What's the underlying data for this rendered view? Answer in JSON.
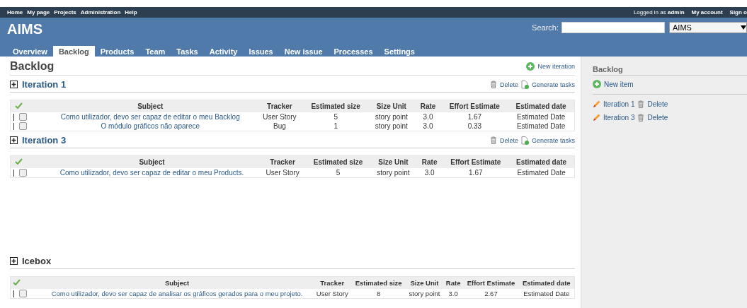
{
  "top_menu": [
    "Home",
    "My page",
    "Projects",
    "Administration",
    "Help"
  ],
  "account": {
    "logged_in_prefix": "Logged in as",
    "user": "admin",
    "links": [
      "My account",
      "Sign o"
    ]
  },
  "header": {
    "title": "AIMS",
    "search_label": "Search:",
    "project_select": "AIMS"
  },
  "tabs": [
    {
      "label": "Overview",
      "selected": false
    },
    {
      "label": "Backlog",
      "selected": true
    },
    {
      "label": "Products",
      "selected": false
    },
    {
      "label": "Team",
      "selected": false
    },
    {
      "label": "Tasks",
      "selected": false
    },
    {
      "label": "Activity",
      "selected": false
    },
    {
      "label": "Issues",
      "selected": false
    },
    {
      "label": "New issue",
      "selected": false
    },
    {
      "label": "Processes",
      "selected": false
    },
    {
      "label": "Settings",
      "selected": false
    }
  ],
  "page_title": "Backlog",
  "new_iteration": "New iteration",
  "sections": [
    {
      "kind": "iteration",
      "title": "Iteration 1",
      "actions": [
        "Delete",
        "Generate tasks"
      ],
      "columns": [
        "Subject",
        "Tracker",
        "Estimated size",
        "Size Unit",
        "Rate",
        "Effort Estimate",
        "Estimated date"
      ],
      "rows": [
        {
          "checked": false,
          "cells": [
            "Como utilizador, devo ser capaz de editar o meu Backlog",
            "User Story",
            "5",
            "story point",
            "3.0",
            "1.67",
            "Estimated Date"
          ]
        },
        {
          "checked": false,
          "cells": [
            "O módulo gráficos não aparece",
            "Bug",
            "1",
            "story point",
            "3.0",
            "0.33",
            "Estimated Date"
          ]
        }
      ]
    },
    {
      "kind": "iteration",
      "title": "Iteration 3",
      "actions": [
        "Delete",
        "Generate tasks"
      ],
      "columns": [
        "Subject",
        "Tracker",
        "Estimated size",
        "Size Unit",
        "Rate",
        "Effort Estimate",
        "Estimated date"
      ],
      "rows": [
        {
          "checked": false,
          "cells": [
            "Como utilizador, devo ser capaz de editar o meu Products.",
            "User Story",
            "5",
            "story point",
            "3.0",
            "1.67",
            "Estimated Date"
          ]
        }
      ]
    },
    {
      "kind": "icebox",
      "title": "Icebox",
      "columns": [
        "Subject",
        "Tracker",
        "Estimated size",
        "Size Unit",
        "Rate",
        "Effort Estimate",
        "Estimated date"
      ],
      "rows": [
        {
          "checked": false,
          "cells": [
            "Como utilizador, devo ser capaz de analisar os gráficos gerados para o meu projeto.",
            "User Story",
            "8",
            "story point",
            "3.0",
            "2.67",
            "Estimated Date"
          ]
        }
      ]
    }
  ],
  "sidebar": {
    "title": "Backlog",
    "new_item": "New item",
    "items": [
      {
        "label": "Iteration 1",
        "action": "Delete"
      },
      {
        "label": "Iteration 3",
        "action": "Delete"
      }
    ]
  }
}
